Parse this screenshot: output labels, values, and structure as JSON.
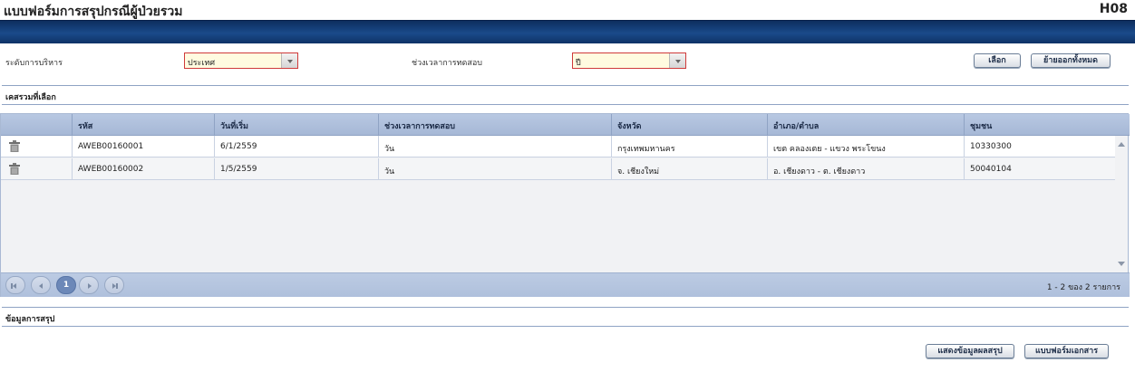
{
  "header": {
    "title": "แบบฟอร์มการสรุปกรณีผู้ป่วยรวม",
    "code": "H08"
  },
  "filters": {
    "admin_level_label": "ระดับการบริหาร",
    "admin_level_value": "ประเทศ",
    "period_label": "ช่วงเวลาการทดสอบ",
    "period_value": "ปี"
  },
  "actions": {
    "select": "เลือก",
    "remove_all": "ย้ายออกทั้งหมด"
  },
  "selected_section": {
    "title": "เคสรวมที่เลือก"
  },
  "table": {
    "columns": [
      "รหัส",
      "วันที่เริ่ม",
      "ช่วงเวลาการทดสอบ",
      "จังหวัด",
      "อำเภอ/ตำบล",
      "ชุมชน"
    ],
    "rows": [
      {
        "code": "AWEB00160001",
        "start": "6/1/2559",
        "period": "วัน",
        "province": "กรุงเทพมหานคร",
        "district": "เขต คลองเตย - แขวง พระโขนง",
        "community": "10330300"
      },
      {
        "code": "AWEB00160002",
        "start": "1/5/2559",
        "period": "วัน",
        "province": "จ. เชียงใหม่",
        "district": "อ. เชียงดาว - ต. เชียงดาว",
        "community": "50040104"
      }
    ]
  },
  "pager": {
    "current_page": "1",
    "summary": "1 - 2 ของ 2 รายการ"
  },
  "summary_section": {
    "title": "ข้อมูลการสรุป"
  },
  "footer": {
    "show_summary": "แสดงข้อมูลผลสรุป",
    "doc_form": "แบบฟอร์มเอกสาร"
  },
  "colors": {
    "banner": "#1a4a8a",
    "required_border": "#cf3a3a",
    "grid_header": "#b8c8e2"
  }
}
